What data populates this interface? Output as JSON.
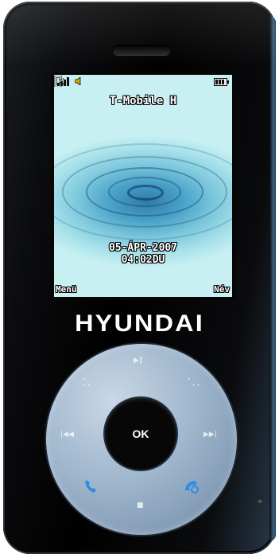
{
  "screen": {
    "operator": "T-Mobile H",
    "date": "05-ÁPR-2007",
    "time": "04:02DU",
    "softkeys": {
      "left": "Menü",
      "center_icon": "exit-arrow-icon",
      "right": "Név"
    },
    "status_icons": [
      "signal-strength-icon",
      "speaker-icon",
      "battery-icon"
    ]
  },
  "brand": "HYUNDAI",
  "keypad": {
    "ok_label": "OK",
    "top_label": "▶‖",
    "left_label": "|◀◀",
    "right_label": "▶▶|",
    "bottom_label": "■",
    "icons": [
      "call-icon",
      "end-call-icon"
    ]
  },
  "colors": {
    "body": "#000000",
    "wheel": "#9fb6cc",
    "accent_blue": "#3a8fd8",
    "screen_water": "#4aa3c8"
  }
}
